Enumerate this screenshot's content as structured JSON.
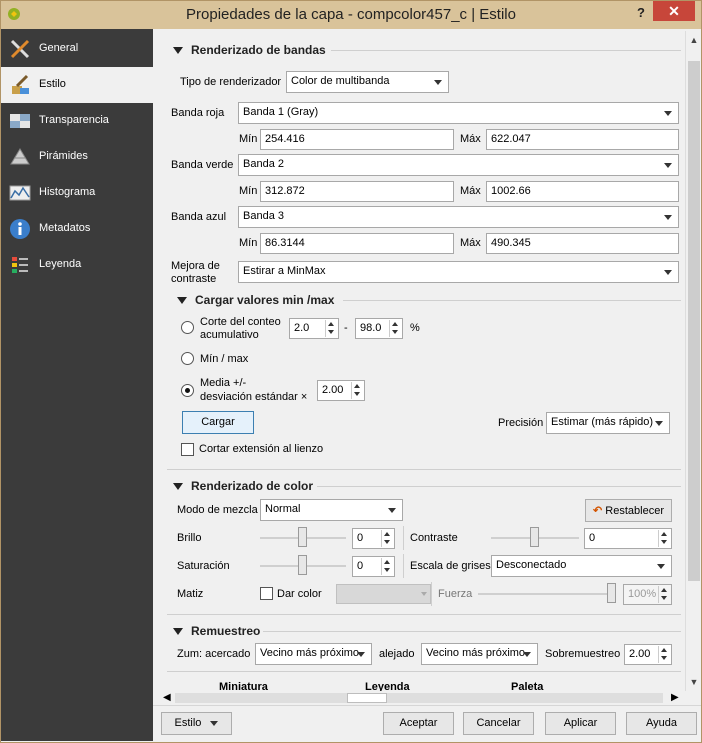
{
  "window": {
    "title": "Propiedades de la capa - compcolor457_c | Estilo",
    "help": "?",
    "close": "✕"
  },
  "sidebar": {
    "items": [
      {
        "label": "General",
        "icon": "tools-icon"
      },
      {
        "label": "Estilo",
        "icon": "brush-icon"
      },
      {
        "label": "Transparencia",
        "icon": "transparency-icon"
      },
      {
        "label": "Pirámides",
        "icon": "pyramids-icon"
      },
      {
        "label": "Histograma",
        "icon": "histogram-icon"
      },
      {
        "label": "Metadatos",
        "icon": "info-icon"
      },
      {
        "label": "Leyenda",
        "icon": "legend-icon"
      }
    ]
  },
  "band_render": {
    "title": "Renderizado de bandas",
    "renderer_type_label": "Tipo de renderizador",
    "renderer_type_value": "Color de multibanda",
    "red_label": "Banda roja",
    "red_value": "Banda 1 (Gray)",
    "red_min_label": "Mín",
    "red_min": "254.416",
    "red_max_label": "Máx",
    "red_max": "622.047",
    "green_label": "Banda verde",
    "green_value": "Banda 2",
    "green_min_label": "Mín",
    "green_min": "312.872",
    "green_max_label": "Máx",
    "green_max": "1002.66",
    "blue_label": "Banda azul",
    "blue_value": "Banda 3",
    "blue_min_label": "Mín",
    "blue_min": "86.3144",
    "blue_max_label": "Máx",
    "blue_max": "490.345",
    "contrast_label_1": "Mejora de",
    "contrast_label_2": "contraste",
    "contrast_value": "Estirar a MinMax"
  },
  "minmax": {
    "title": "Cargar valores min /max",
    "cumulative_label_1": "Corte del conteo",
    "cumulative_label_2": "acumulativo",
    "cum_from": "2.0",
    "dash": "-",
    "cum_to": "98.0",
    "percent": "%",
    "minmax_label": "Mín / max",
    "stddev_label_1": "Media +/-",
    "stddev_label_2": "desviación estándar ×",
    "stddev_value": "2.00",
    "load_button": "Cargar",
    "precision_label": "Precisión",
    "precision_value": "Estimar (más rápido)",
    "clip_label": "Cortar extensión al lienzo"
  },
  "color_render": {
    "title": "Renderizado de color",
    "blend_label": "Modo de mezcla",
    "blend_value": "Normal",
    "reset_button": "Restablecer",
    "brightness_label": "Brillo",
    "brightness_value": "0",
    "contrast_label": "Contraste",
    "contrast_value": "0",
    "saturation_label": "Saturación",
    "saturation_value": "0",
    "grayscale_label": "Escala de grises",
    "grayscale_value": "Desconectado",
    "hue_label": "Matiz",
    "colorize_label": "Dar color",
    "strength_label": "Fuerza",
    "strength_value": "100%"
  },
  "resampling": {
    "title": "Remuestreo",
    "zoom_in_label": "Zum: acercado",
    "zoom_in_value": "Vecino más próximo",
    "zoom_out_label": "alejado",
    "zoom_out_value": "Vecino más próximo",
    "oversampling_label": "Sobremuestreo",
    "oversampling_value": "2.00"
  },
  "bottom_tabs": [
    "Miniatura",
    "Leyenda",
    "Paleta"
  ],
  "footer": {
    "style_button": "Estilo",
    "accept": "Aceptar",
    "cancel": "Cancelar",
    "apply": "Aplicar",
    "help": "Ayuda"
  },
  "colors": {
    "sidebar_bg": "#3b3b3b",
    "title_bg": "#d9c39a",
    "close_bg": "#c7463a"
  }
}
